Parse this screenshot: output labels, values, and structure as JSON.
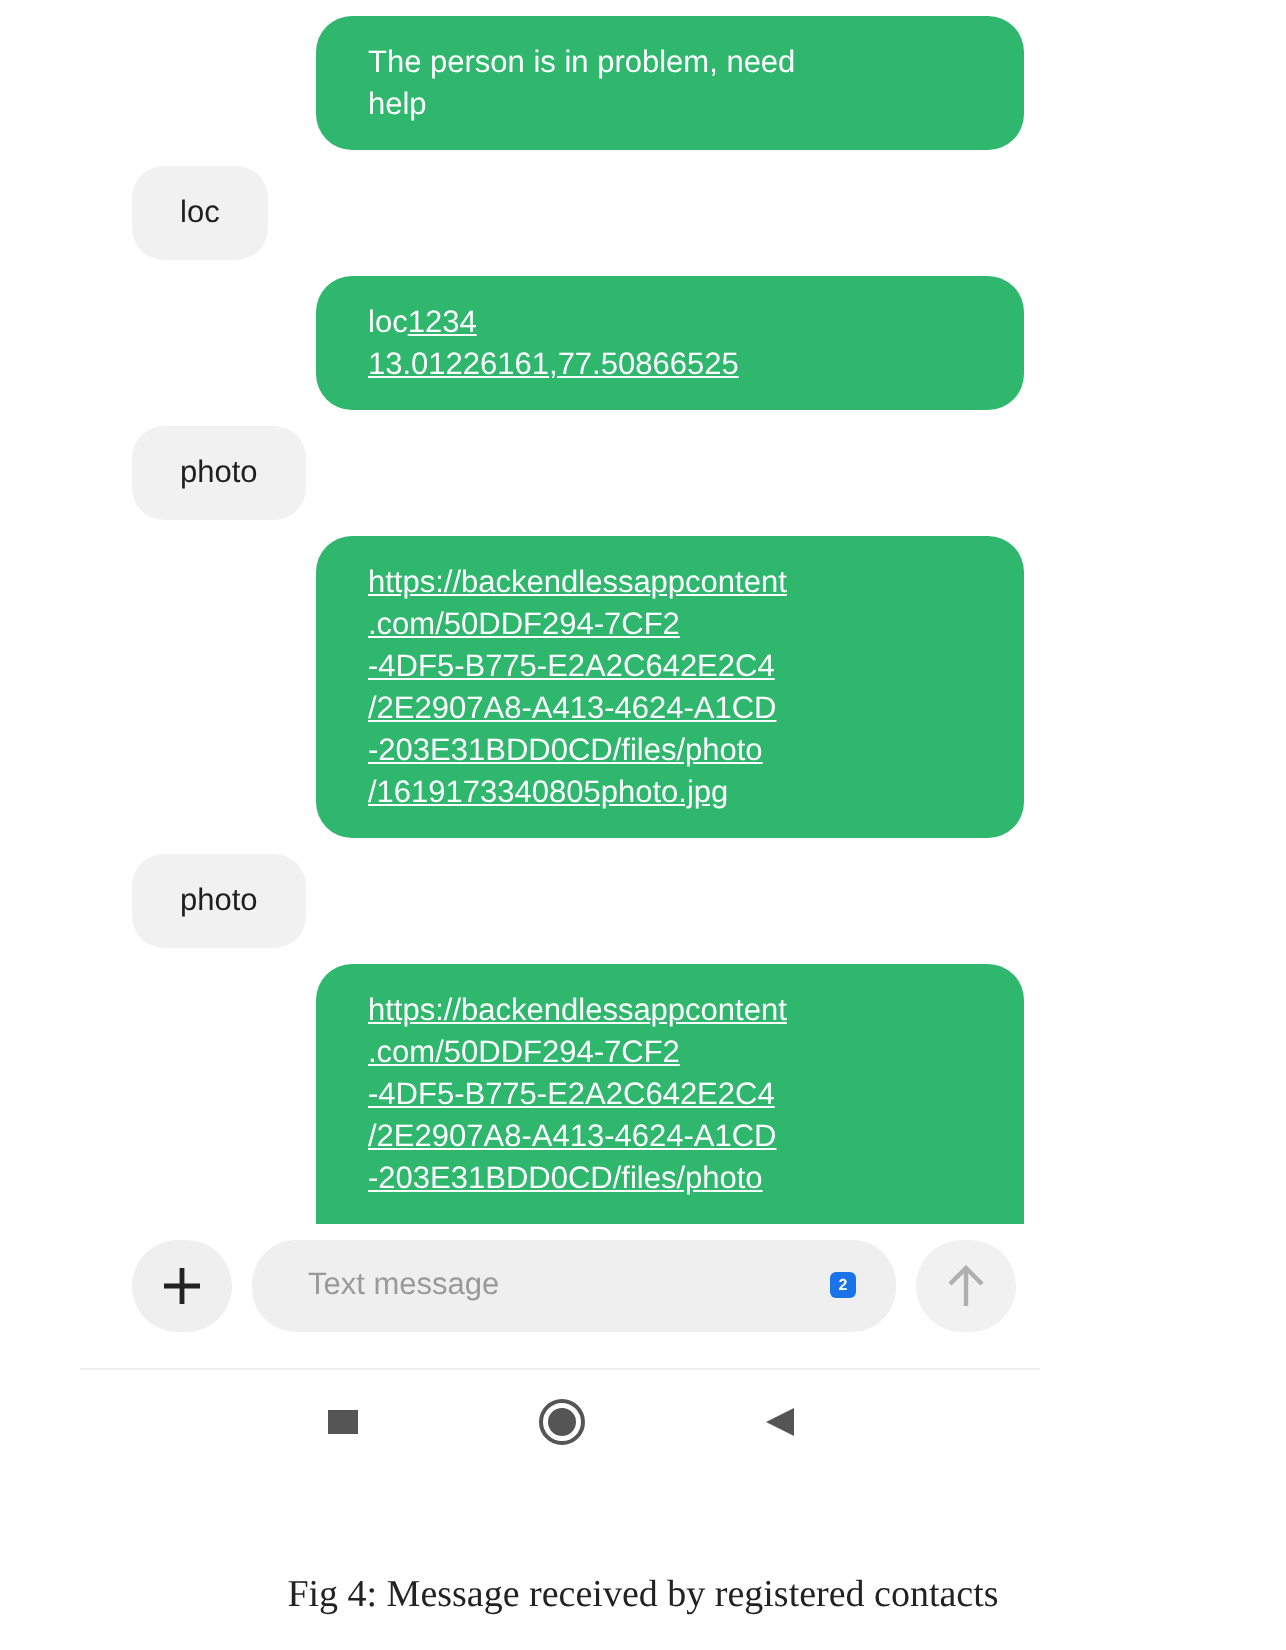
{
  "messages": [
    {
      "kind": "sent",
      "lines": [
        [
          {
            "text": "The person is in problem, need",
            "link": false
          }
        ],
        [
          {
            "text": "help",
            "link": false
          }
        ]
      ]
    },
    {
      "kind": "received",
      "lines": [
        [
          {
            "text": "loc",
            "link": false
          }
        ]
      ]
    },
    {
      "kind": "sent",
      "lines": [
        [
          {
            "text": "loc",
            "link": false
          },
          {
            "text": "1234",
            "link": true
          }
        ],
        [
          {
            "text": "13.01226161,77.50866525",
            "link": true
          }
        ]
      ]
    },
    {
      "kind": "received",
      "lines": [
        [
          {
            "text": "photo",
            "link": false
          }
        ]
      ]
    },
    {
      "kind": "sent",
      "lines": [
        [
          {
            "text": "https://backendlessappcontent",
            "link": true
          }
        ],
        [
          {
            "text": ".com/50DDF294-7CF2",
            "link": true
          }
        ],
        [
          {
            "text": "-4DF5-B775-E2A2C642E2C4",
            "link": true
          }
        ],
        [
          {
            "text": "/2E2907A8-A413-4624-A1CD",
            "link": true
          }
        ],
        [
          {
            "text": "-203E31BDD0CD/files/photo",
            "link": true
          }
        ],
        [
          {
            "text": "/1619173340805photo.jpg",
            "link": true
          }
        ]
      ]
    },
    {
      "kind": "received",
      "lines": [
        [
          {
            "text": "photo",
            "link": false
          }
        ]
      ]
    },
    {
      "kind": "sent",
      "lines": [
        [
          {
            "text": "https://backendlessappcontent",
            "link": true
          }
        ],
        [
          {
            "text": ".com/50DDF294-7CF2",
            "link": true
          }
        ],
        [
          {
            "text": "-4DF5-B775-E2A2C642E2C4",
            "link": true
          }
        ],
        [
          {
            "text": "/2E2907A8-A413-4624-A1CD",
            "link": true
          }
        ],
        [
          {
            "text": "-203E31BDD0CD/files/photo",
            "link": true
          }
        ]
      ]
    }
  ],
  "composer": {
    "placeholder": "Text message",
    "sim_badge": "2",
    "send_disabled": true
  },
  "caption": "Fig 4: Message received by registered contacts"
}
